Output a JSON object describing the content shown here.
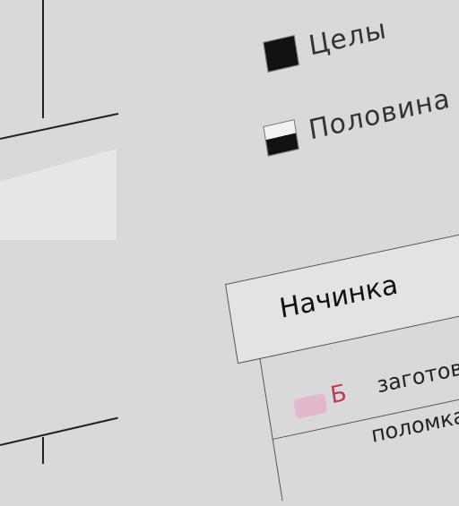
{
  "legend": {
    "items": [
      {
        "label": "Целы",
        "swatch": "full",
        "color": "#111111"
      },
      {
        "label": "Половина",
        "swatch": "half",
        "color": "#111111"
      }
    ]
  },
  "table": {
    "header": "Начинка",
    "rows": [
      {
        "code": "Б",
        "name": "заготовк",
        "tag_color": "#e3b8cd"
      },
      {
        "code": "",
        "name": "поломка"
      }
    ]
  }
}
